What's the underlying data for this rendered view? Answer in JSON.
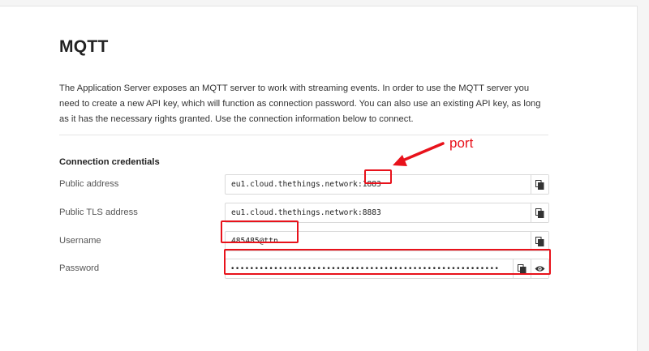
{
  "section": {
    "title": "MQTT",
    "description": "The Application Server exposes an MQTT server to work with streaming events. In order to use the MQTT server you need to create a new API key, which will function as connection password. You can also use an existing API key, as long as it has the necessary rights granted. Use the connection information below to connect."
  },
  "credentials": {
    "title": "Connection credentials",
    "public_address": {
      "label": "Public address",
      "value": "eu1.cloud.thethings.network:1883"
    },
    "public_tls_address": {
      "label": "Public TLS address",
      "value": "eu1.cloud.thethings.network:8883"
    },
    "username": {
      "label": "Username",
      "value": "485485@ttn"
    },
    "password": {
      "label": "Password",
      "value": "••••••••••••••••••••••••••••••••••••••••••••••••••••••••"
    }
  },
  "annotation": {
    "text": "port",
    "color": "#e8121b"
  },
  "icons": {
    "copy": "copy-icon",
    "show": "eye-icon"
  }
}
